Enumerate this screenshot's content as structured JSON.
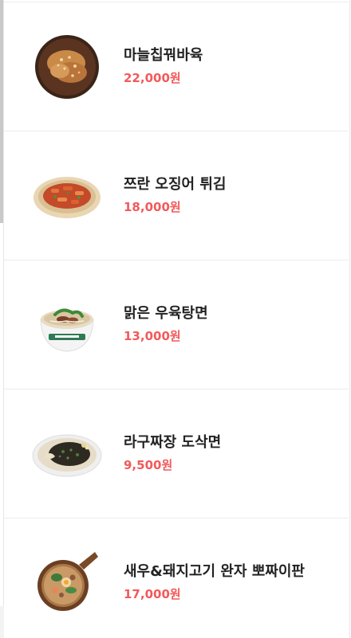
{
  "menu": {
    "items": [
      {
        "name": "마늘칩꿔바육",
        "price": "22,000원",
        "icon": "garlic-chip-pork-dish"
      },
      {
        "name": "쯔란 오징어 튀김",
        "price": "18,000원",
        "icon": "cumin-squid-fry-dish"
      },
      {
        "name": "맑은 우육탕면",
        "price": "13,000원",
        "icon": "beef-noodle-soup-bowl"
      },
      {
        "name": "라구짜장 도삭면",
        "price": "9,500원",
        "icon": "ragu-jjajang-noodle-dish"
      },
      {
        "name": "새우&돼지고기 완자 뽀짜이판",
        "price": "17,000원",
        "icon": "claypot-rice-dish"
      }
    ]
  },
  "colors": {
    "price": "#f25a5a",
    "name": "#222222",
    "divider": "#ececec"
  }
}
